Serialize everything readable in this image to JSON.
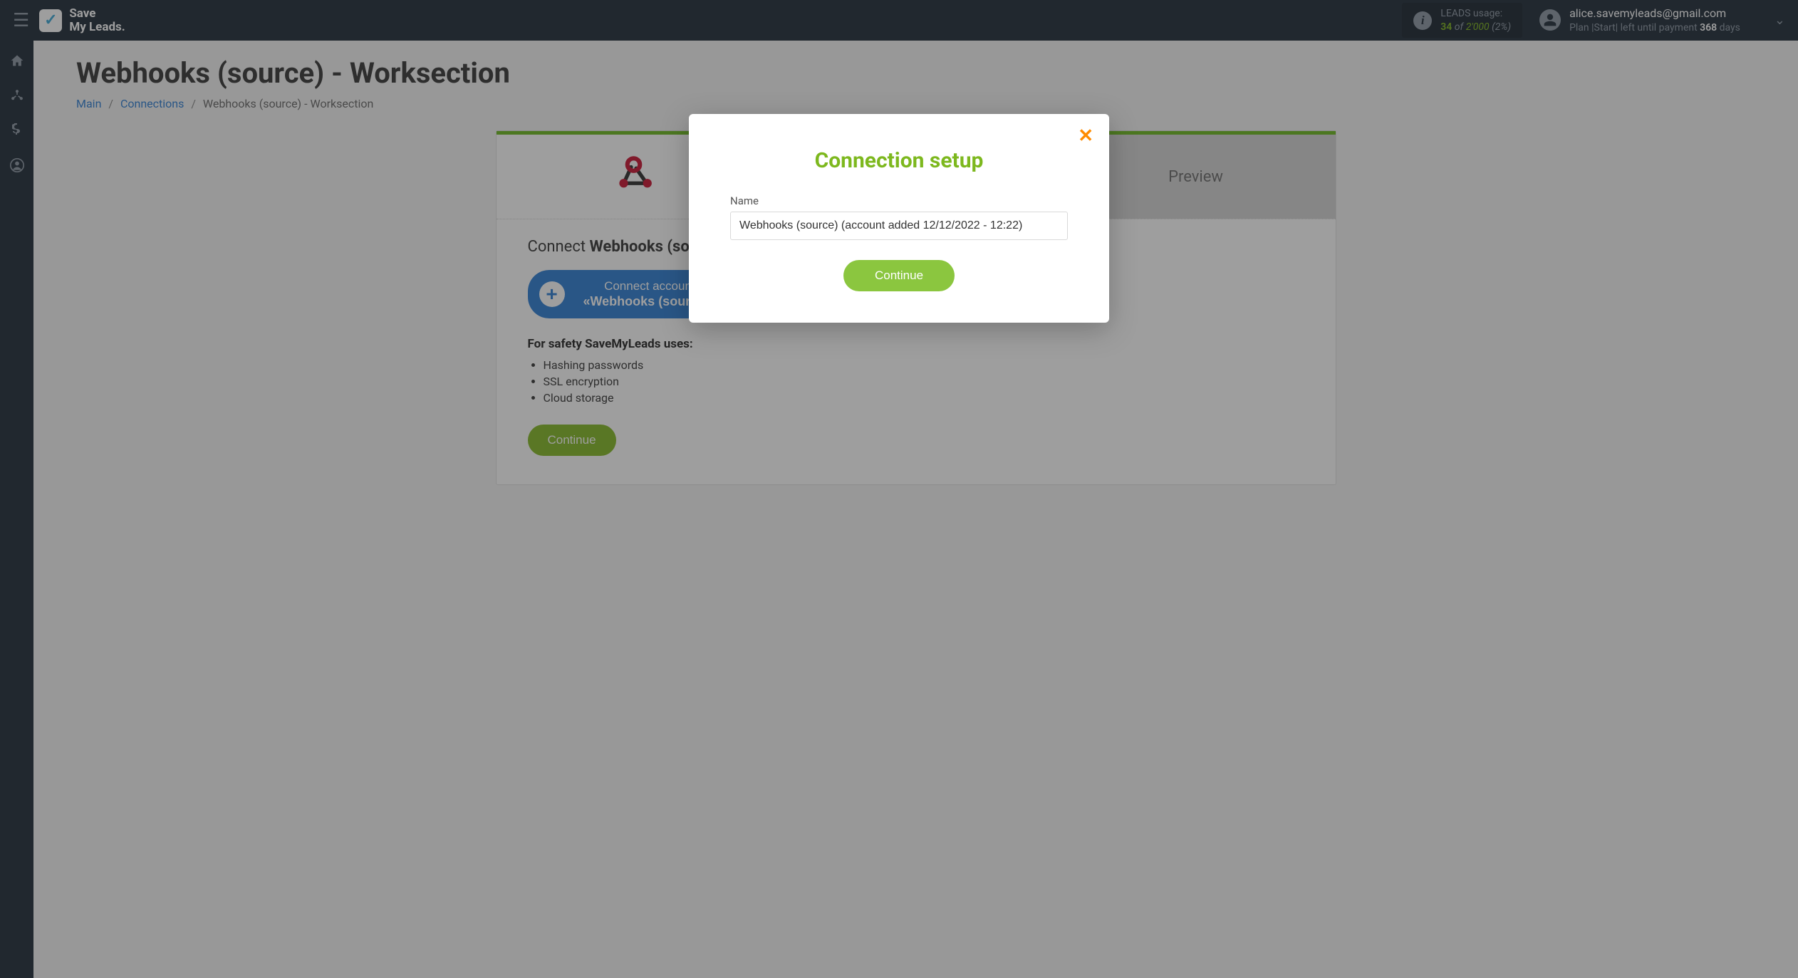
{
  "brand": {
    "line1": "Save",
    "line2": "My Leads."
  },
  "leads": {
    "label": "LEADS usage:",
    "used": "34",
    "of": "of",
    "total": "2'000",
    "pct": "(2%)"
  },
  "user": {
    "email": "alice.savemyleads@gmail.com",
    "plan_prefix": "Plan |",
    "plan_name": "Start",
    "plan_mid": "| left until payment ",
    "days": "368",
    "plan_suffix": " days"
  },
  "page": {
    "title": "Webhooks (source) - Worksection",
    "breadcrumb": {
      "main": "Main",
      "connections": "Connections",
      "current": "Webhooks (source) - Worksection"
    }
  },
  "tabs": {
    "source": "",
    "target": "",
    "preview": "Preview"
  },
  "connect": {
    "heading_prefix": "Connect ",
    "heading_bold": "Webhooks (source)",
    "btn_line1": "Connect account",
    "btn_line2": "«Webhooks (source)»",
    "safety_title": "For safety SaveMyLeads uses:",
    "safety": [
      "Hashing passwords",
      "SSL encryption",
      "Cloud storage"
    ],
    "continue": "Continue"
  },
  "modal": {
    "title": "Connection setup",
    "name_label": "Name",
    "name_value": "Webhooks (source) (account added 12/12/2022 - 12:22)",
    "continue": "Continue"
  }
}
